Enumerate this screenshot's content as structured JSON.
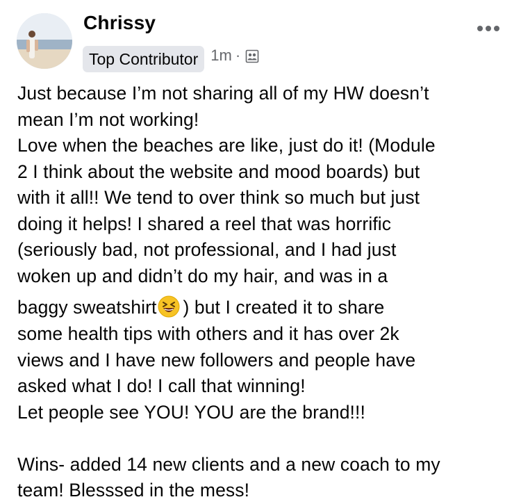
{
  "post": {
    "author": "Chrissy",
    "badge": "Top Contributor",
    "time": "1m",
    "separator": "·",
    "audience_icon": "group-audience-icon",
    "more_icon": "more-options-icon",
    "emoji_icon": "grinning-squinting-face-emoji",
    "lines": {
      "l1": "Just because I’m not sharing all of my HW doesn’t",
      "l2": "mean I’m not working!",
      "l3": "Love when the beaches are like, just do it! (Module",
      "l4": "2 I think about the website and mood boards) but",
      "l5": "with it all!! We tend to over think so much but just",
      "l6": "doing it helps! I shared a reel that was horrific",
      "l7": "(seriously bad, not professional, and I had just",
      "l8": "woken up and didn’t do my hair, and was in a",
      "l9a": "baggy sweatshirt",
      "l9b": ") but I created it to share",
      "l10": "some health tips with others and it has over 2k",
      "l11": "views and I have new followers and people have",
      "l12": "asked what I do! I call that winning!",
      "l13": "Let people see YOU! YOU are the brand!!!",
      "l14": "Wins- added 14 new clients and a new coach to my",
      "l15": "team! Blesssed in the mess!"
    }
  },
  "colors": {
    "text": "#050505",
    "secondary": "#65676b",
    "badge_bg": "#e4e6eb"
  }
}
